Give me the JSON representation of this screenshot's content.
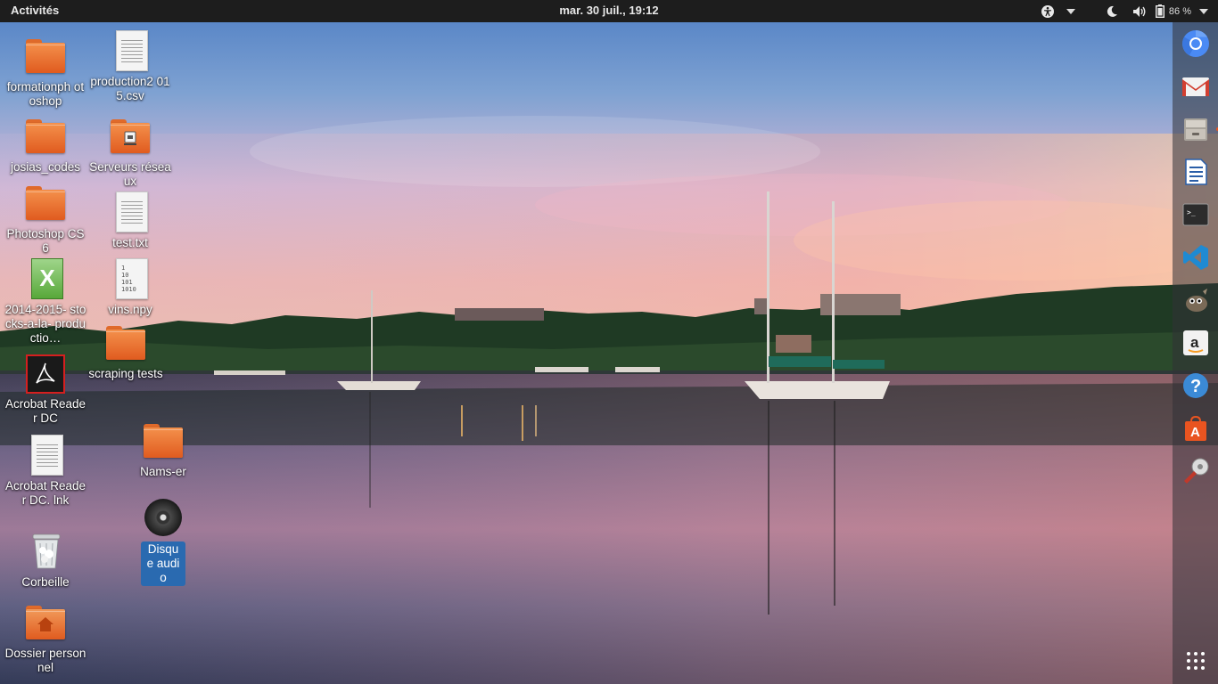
{
  "topbar": {
    "activities": "Activités",
    "clock": "mar. 30 juil., 19:12",
    "battery": "86 %",
    "icons": [
      "accessibility-icon",
      "chevron-down-icon",
      "night-light-icon",
      "volume-icon",
      "battery-icon",
      "chevron-down-icon"
    ]
  },
  "desktop": {
    "icons": [
      {
        "label": "formationph otoshop",
        "type": "folder"
      },
      {
        "label": "josias_codes",
        "type": "folder"
      },
      {
        "label": "Photoshop CS6",
        "type": "folder"
      },
      {
        "label": "2014-2015- stocks-a-la- productio…",
        "type": "spreadsheet"
      },
      {
        "label": "Acrobat Reader DC",
        "type": "acrobat"
      },
      {
        "label": "Acrobat Reader DC. lnk",
        "type": "document"
      },
      {
        "label": "Corbeille",
        "type": "trash"
      },
      {
        "label": "Dossier personnel",
        "type": "home-folder"
      },
      {
        "label": "production2 015.csv",
        "type": "document"
      },
      {
        "label": "Serveurs réseaux",
        "type": "network-folder"
      },
      {
        "label": "test.txt",
        "type": "document"
      },
      {
        "label": "vins.npy",
        "type": "binary-document"
      },
      {
        "label": "scraping tests",
        "type": "folder"
      },
      {
        "label": "Nams-er",
        "type": "folder"
      },
      {
        "label": "Disque audio",
        "type": "audio-disc",
        "selected": true
      }
    ],
    "binary_text": "1\n10\n101\n1010"
  },
  "dock": {
    "items": [
      {
        "name": "chromium-icon"
      },
      {
        "name": "gmail-icon"
      },
      {
        "name": "file-manager-icon",
        "running": true
      },
      {
        "name": "writer-icon"
      },
      {
        "name": "terminal-icon"
      },
      {
        "name": "vscode-icon"
      },
      {
        "name": "gimp-icon"
      },
      {
        "name": "amazon-icon"
      },
      {
        "name": "help-icon"
      },
      {
        "name": "software-center-icon"
      },
      {
        "name": "settings-tools-icon"
      },
      {
        "name": "show-applications-icon"
      }
    ],
    "terminal_prompt": ">_",
    "amazon_letter": "a",
    "help_mark": "?",
    "software_letter": "A"
  },
  "colors": {
    "accent": "#e95420",
    "topbar": "#1d1d1d",
    "selection": "#2a6ab0"
  }
}
